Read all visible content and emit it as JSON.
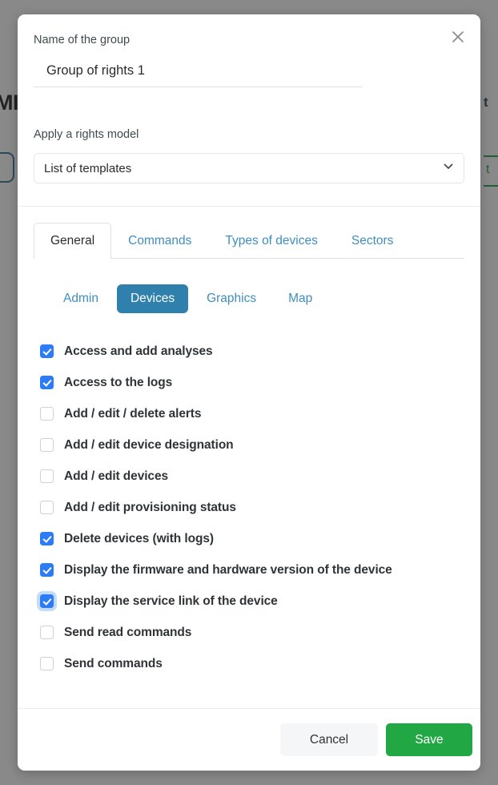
{
  "background": {
    "title_fragment": "MI",
    "right_fragment": "t",
    "right_green_fragment": "t"
  },
  "modal": {
    "close_icon": "close-icon",
    "name_field": {
      "label": "Name of the group",
      "value": "Group of rights 1",
      "placeholder": "Name of the group"
    },
    "rights_model": {
      "label": "Apply a rights model",
      "selected": "List of templates",
      "caret_icon": "chevron-down-icon",
      "options": [
        "List of templates"
      ]
    },
    "tabs": [
      {
        "label": "General",
        "active": true
      },
      {
        "label": "Commands",
        "active": false
      },
      {
        "label": "Types of devices",
        "active": false
      },
      {
        "label": "Sectors",
        "active": false
      }
    ],
    "subtabs": [
      {
        "label": "Admin",
        "active": false
      },
      {
        "label": "Devices",
        "active": true
      },
      {
        "label": "Graphics",
        "active": false
      },
      {
        "label": "Map",
        "active": false
      }
    ],
    "permissions": [
      {
        "label": "Access and add analyses",
        "checked": true,
        "focused": false
      },
      {
        "label": "Access to the logs",
        "checked": true,
        "focused": false
      },
      {
        "label": "Add / edit / delete alerts",
        "checked": false,
        "focused": false
      },
      {
        "label": "Add / edit device designation",
        "checked": false,
        "focused": false
      },
      {
        "label": "Add / edit devices",
        "checked": false,
        "focused": false
      },
      {
        "label": "Add / edit provisioning status",
        "checked": false,
        "focused": false
      },
      {
        "label": "Delete devices (with logs)",
        "checked": true,
        "focused": false
      },
      {
        "label": "Display the firmware and hardware version of the device",
        "checked": true,
        "focused": false
      },
      {
        "label": "Display the service link of the device",
        "checked": true,
        "focused": true
      },
      {
        "label": "Send read commands",
        "checked": false,
        "focused": false
      },
      {
        "label": "Send commands",
        "checked": false,
        "focused": false
      }
    ],
    "footer": {
      "cancel_label": "Cancel",
      "save_label": "Save"
    }
  },
  "colors": {
    "accent_blue": "#3080ad",
    "link_blue": "#3f8dbf",
    "checkbox_blue": "#2b7cf6",
    "save_green": "#22a745",
    "overlay": "#7b7b7b"
  }
}
